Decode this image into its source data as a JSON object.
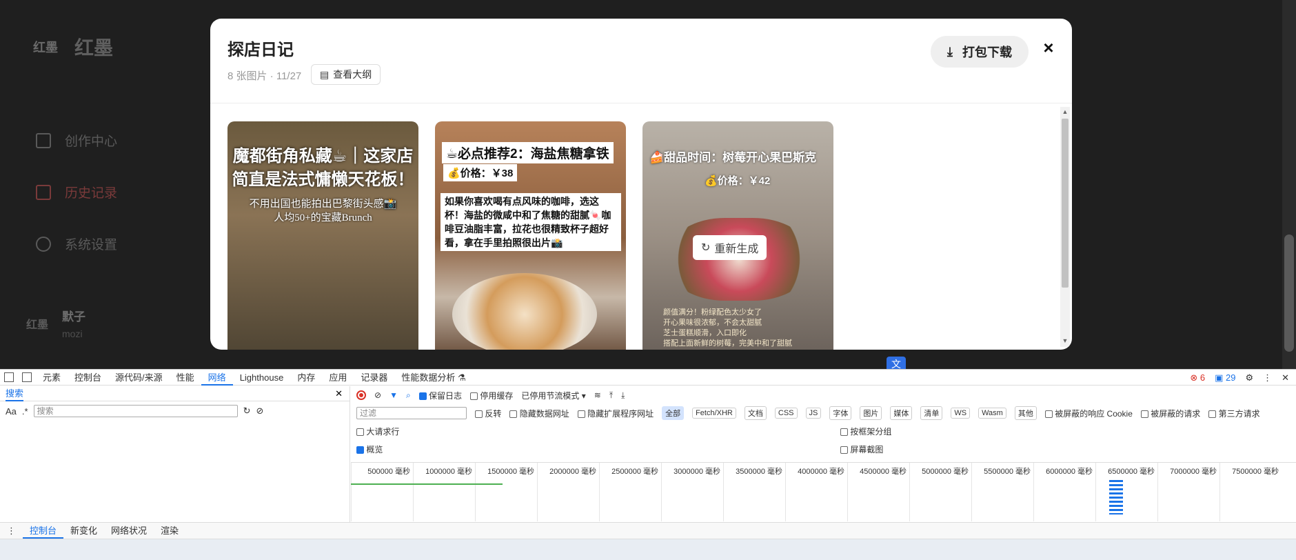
{
  "app": {
    "logo_text": "红墨",
    "brand_name": "红墨",
    "nav": [
      {
        "label": "创作中心",
        "icon": "grid-icon"
      },
      {
        "label": "历史记录",
        "icon": "document-icon"
      },
      {
        "label": "系统设置",
        "icon": "gear-icon"
      }
    ],
    "user": {
      "avatar_text": "红墨",
      "name": "默子",
      "id": "mozi"
    }
  },
  "modal": {
    "title": "探店日记",
    "subtitle": "8 张图片 · 11/27",
    "outline_button": "查看大纲",
    "download_button": "打包下载",
    "close": "×",
    "cards": [
      {
        "line1": "魔都街角私藏☕｜这家店",
        "line2": "简直是法式慵懒天花板！",
        "line3": "不用出国也能拍出巴黎街头感📸",
        "line4": "人均50+的宝藏Brunch"
      },
      {
        "heading": "☕必点推荐2：海盐焦糖拿铁",
        "price": "💰价格：￥38",
        "body": "如果你喜欢喝有点风味的咖啡，选这杯！海盐的微咸中和了焦糖的甜腻🍬咖啡豆油脂丰富，拉花也很精致杯子超好看，拿在手里拍照很出片📸"
      },
      {
        "heading": "🍰甜品时间：树莓开心果巴斯克",
        "price": "💰价格：￥42",
        "regen": "重新生成",
        "notes": [
          "颜值满分！粉绿配色太少女了",
          "开心果味很浓郁，不会太甜腻",
          "芝士蛋糕顺滑，入口即化",
          "搭配上面新鲜的树莓，完美中和了甜腻"
        ]
      }
    ]
  },
  "translate_badge": "文",
  "devtools": {
    "tabs": [
      "元素",
      "控制台",
      "源代码/来源",
      "性能",
      "网络",
      "Lighthouse",
      "内存",
      "应用",
      "记录器",
      "性能数据分析 ⚗"
    ],
    "active_tab": "网络",
    "errors": "6",
    "messages": "29",
    "left": {
      "tab": "搜索",
      "case_label": "Aa",
      "regex_label": ".*",
      "search_placeholder": "搜索"
    },
    "toolbar": {
      "preserve_log": "保留日志",
      "disable_cache": "停用缓存",
      "throttle": "已停用节流模式"
    },
    "filter": {
      "placeholder": "过滤",
      "invert": "反转",
      "hide_data_urls": "隐藏数据网址",
      "hide_ext_urls": "隐藏扩展程序网址",
      "types": [
        "全部",
        "Fetch/XHR",
        "文档",
        "CSS",
        "JS",
        "字体",
        "图片",
        "媒体",
        "清单",
        "WS",
        "Wasm",
        "其他"
      ],
      "blocked_cookies": "被屏蔽的响应 Cookie",
      "blocked_requests": "被屏蔽的请求",
      "third_party": "第三方请求"
    },
    "options": {
      "big_rows": "大请求行",
      "group_by_frame": "按框架分组",
      "overview": "概览",
      "screenshots": "屏幕截图"
    },
    "timeline_ticks": [
      "500000 毫秒",
      "1000000 毫秒",
      "1500000 毫秒",
      "2000000 毫秒",
      "2500000 毫秒",
      "3000000 毫秒",
      "3500000 毫秒",
      "4000000 毫秒",
      "4500000 毫秒",
      "5000000 毫秒",
      "5500000 毫秒",
      "6000000 毫秒",
      "6500000 毫秒",
      "7000000 毫秒",
      "7500000 毫秒"
    ],
    "drawer_tabs": [
      "控制台",
      "新变化",
      "网络状况",
      "渲染"
    ],
    "drawer_active": "控制台"
  }
}
